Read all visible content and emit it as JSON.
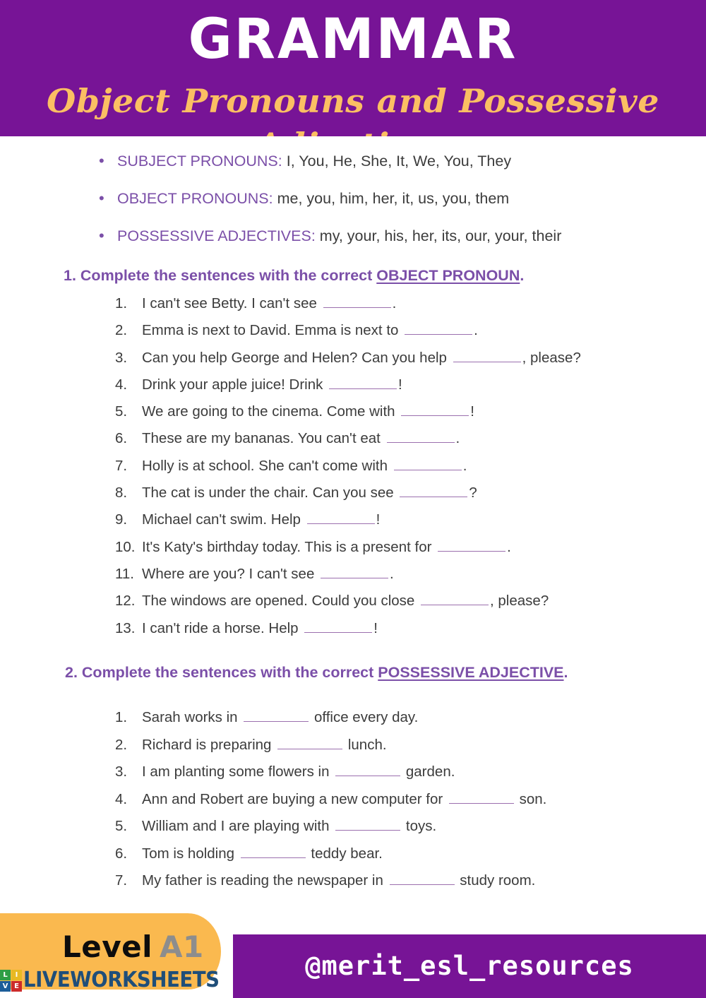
{
  "header": {
    "title": "GRAMMAR",
    "subtitle": "Object Pronouns and Possessive Adjectives",
    "background_color": "#771496",
    "title_color": "#FFFFFF",
    "subtitle_color": "#FBBF63"
  },
  "definitions": [
    {
      "bullet": "•",
      "label": "SUBJECT PRONOUNS:",
      "values": "I, You, He, She, It, We, You, They"
    },
    {
      "bullet": "•",
      "label": "OBJECT PRONOUNS:",
      "values": "me, you, him, her, it, us, you, them"
    },
    {
      "bullet": "•",
      "label": "POSSESSIVE ADJECTIVES:",
      "values": "my, your, his, her, its, our, your, their"
    }
  ],
  "exercise_1": {
    "heading_prefix": "1. Complete the sentences with the correct ",
    "heading_underlined": "OBJECT PRONOUN",
    "heading_suffix": ".",
    "items": [
      {
        "num": "1.",
        "before": "I can't see Betty. I can't see",
        "after": "."
      },
      {
        "num": "2.",
        "before": "Emma is next to David. Emma is next to",
        "after": "."
      },
      {
        "num": "3.",
        "before": "Can you help George and Helen? Can you help",
        "after": ", please?"
      },
      {
        "num": "4.",
        "before": "Drink your apple juice! Drink",
        "after": "!"
      },
      {
        "num": "5.",
        "before": "We are going to the cinema. Come with",
        "after": "!"
      },
      {
        "num": "6.",
        "before": "These are my bananas. You can't eat",
        "after": "."
      },
      {
        "num": "7.",
        "before": "Holly is at school. She can't come with",
        "after": "."
      },
      {
        "num": "8.",
        "before": "The cat is under the chair. Can you see",
        "after": "?"
      },
      {
        "num": "9.",
        "before": "Michael can't swim. Help",
        "after": "!"
      },
      {
        "num": "10.",
        "before": "It's Katy's birthday today. This is a present for",
        "after": "."
      },
      {
        "num": "11.",
        "before": "Where are you? I can't see",
        "after": "."
      },
      {
        "num": "12.",
        "before": "The windows are opened. Could you close",
        "after": ", please?"
      },
      {
        "num": "13.",
        "before": "I can't ride a horse. Help",
        "after": "!"
      }
    ]
  },
  "exercise_2": {
    "heading_prefix": "2. Complete the sentences with the correct ",
    "heading_underlined": "POSSESSIVE ADJECTIVE",
    "heading_suffix": ".",
    "items": [
      {
        "num": "1.",
        "before": "Sarah works in",
        "after": "office every day."
      },
      {
        "num": "2.",
        "before": "Richard is preparing",
        "after": "lunch."
      },
      {
        "num": "3.",
        "before": "I am planting some flowers in",
        "after": "garden."
      },
      {
        "num": "4.",
        "before": "Ann and Robert are buying a new computer for",
        "after": "son."
      },
      {
        "num": "5.",
        "before": "William and I are playing with",
        "after": "toys."
      },
      {
        "num": "6.",
        "before": "Tom is holding",
        "after": "teddy bear."
      },
      {
        "num": "7.",
        "before": "My father is reading the newspaper in",
        "after": "study room."
      }
    ]
  },
  "footer": {
    "level_word": "Level",
    "level_code": "A1",
    "handle": "@merit_esl_resources",
    "badge_color": "#FAB94F",
    "bar_color": "#771496",
    "watermark": {
      "tiles": [
        "L",
        "I",
        "V",
        "E"
      ],
      "word": "LIVEWORKSHEETS"
    }
  },
  "colors": {
    "brand_purple": "#771496",
    "heading_violet": "#7B4FA8",
    "accent_gold": "#FBBF63",
    "body_text": "#3C3C3C",
    "blank_line": "#9B6FAE"
  }
}
